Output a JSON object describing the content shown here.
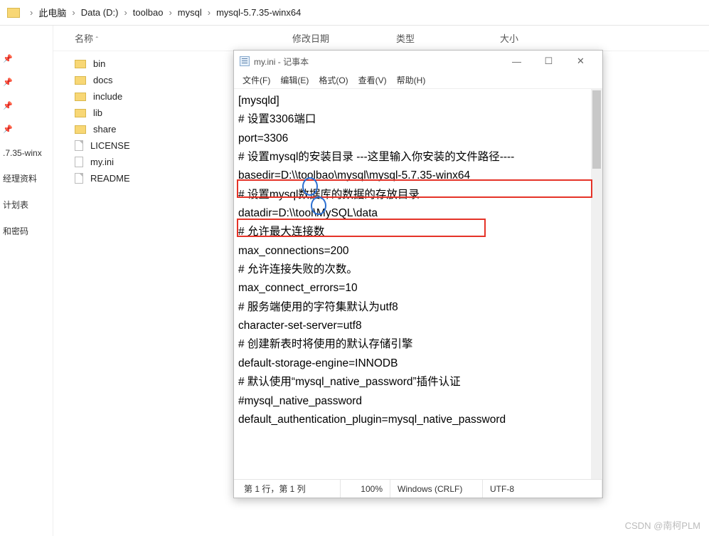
{
  "breadcrumb": [
    "此电脑",
    "Data (D:)",
    "toolbao",
    "mysql",
    "mysql-5.7.35-winx64"
  ],
  "quick_access": [
    ".7.35-winx",
    "经理资料",
    "计划表",
    "和密码"
  ],
  "columns": {
    "name": "名称",
    "mod": "修改日期",
    "type": "类型",
    "size": "大小"
  },
  "files": [
    {
      "name": "bin",
      "kind": "folder"
    },
    {
      "name": "docs",
      "kind": "folder"
    },
    {
      "name": "include",
      "kind": "folder"
    },
    {
      "name": "lib",
      "kind": "folder"
    },
    {
      "name": "share",
      "kind": "folder"
    },
    {
      "name": "LICENSE",
      "kind": "file"
    },
    {
      "name": "my.ini",
      "kind": "ini"
    },
    {
      "name": "README",
      "kind": "file"
    }
  ],
  "notepad": {
    "title": "my.ini - 记事本",
    "menu": [
      "文件(F)",
      "编辑(E)",
      "格式(O)",
      "查看(V)",
      "帮助(H)"
    ],
    "content": "[mysqld]\n# 设置3306端口\nport=3306\n# 设置mysql的安装目录 ---这里输入你安装的文件路径----\nbasedir=D:\\\\toolbao\\mysql\\mysql-5.7.35-winx64\n# 设置mysql数据库的数据的存放目录\ndatadir=D:\\\\tool\\MySQL\\data\n# 允许最大连接数\nmax_connections=200\n# 允许连接失败的次数。\nmax_connect_errors=10\n# 服务端使用的字符集默认为utf8\ncharacter-set-server=utf8\n# 创建新表时将使用的默认存储引擎\ndefault-storage-engine=INNODB\n# 默认使用“mysql_native_password”插件认证\n#mysql_native_password\ndefault_authentication_plugin=mysql_native_password",
    "status": {
      "pos": "第 1 行，第 1 列",
      "zoom": "100%",
      "enc": "Windows (CRLF)",
      "cp": "UTF-8"
    }
  },
  "watermark": "CSDN @南柯PLM"
}
